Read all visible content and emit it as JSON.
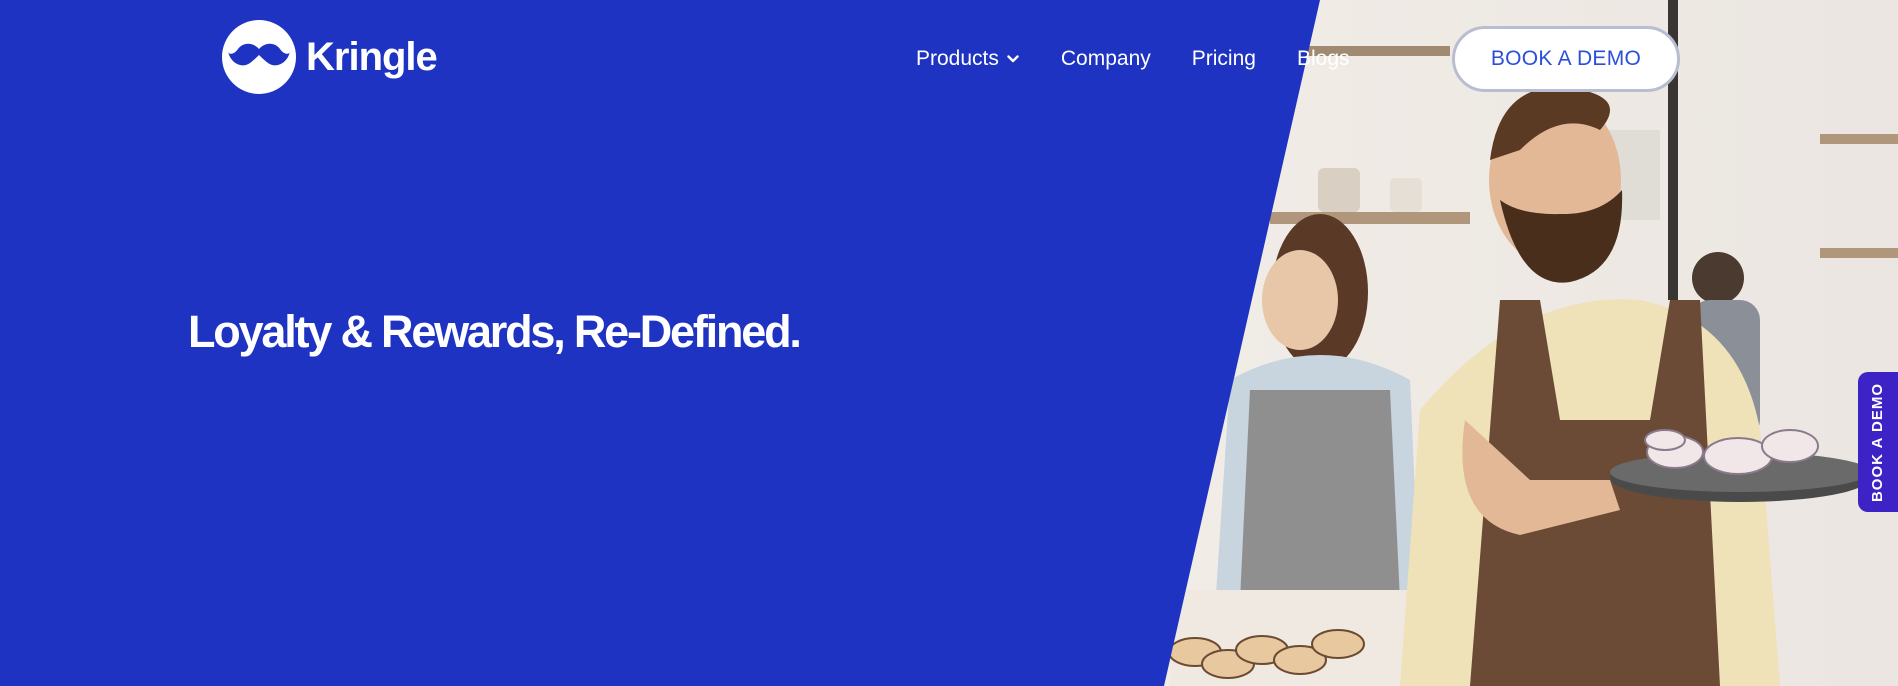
{
  "brand": {
    "name": "Kringle",
    "logo_icon": "mustache-icon"
  },
  "nav": {
    "items": [
      {
        "label": "Products",
        "icon": "chevron-down-icon"
      },
      {
        "label": "Company"
      },
      {
        "label": "Pricing"
      },
      {
        "label": "Blogs"
      }
    ]
  },
  "cta": {
    "label": "BOOK A DEMO"
  },
  "hero": {
    "title": "Loyalty & Rewards, Re-Defined."
  },
  "side_tab": {
    "label": "BOOK A DEMO"
  },
  "colors": {
    "brand_blue": "#1e33c1",
    "cta_text": "#2b4fd8",
    "side_tab": "#3d22c6"
  }
}
